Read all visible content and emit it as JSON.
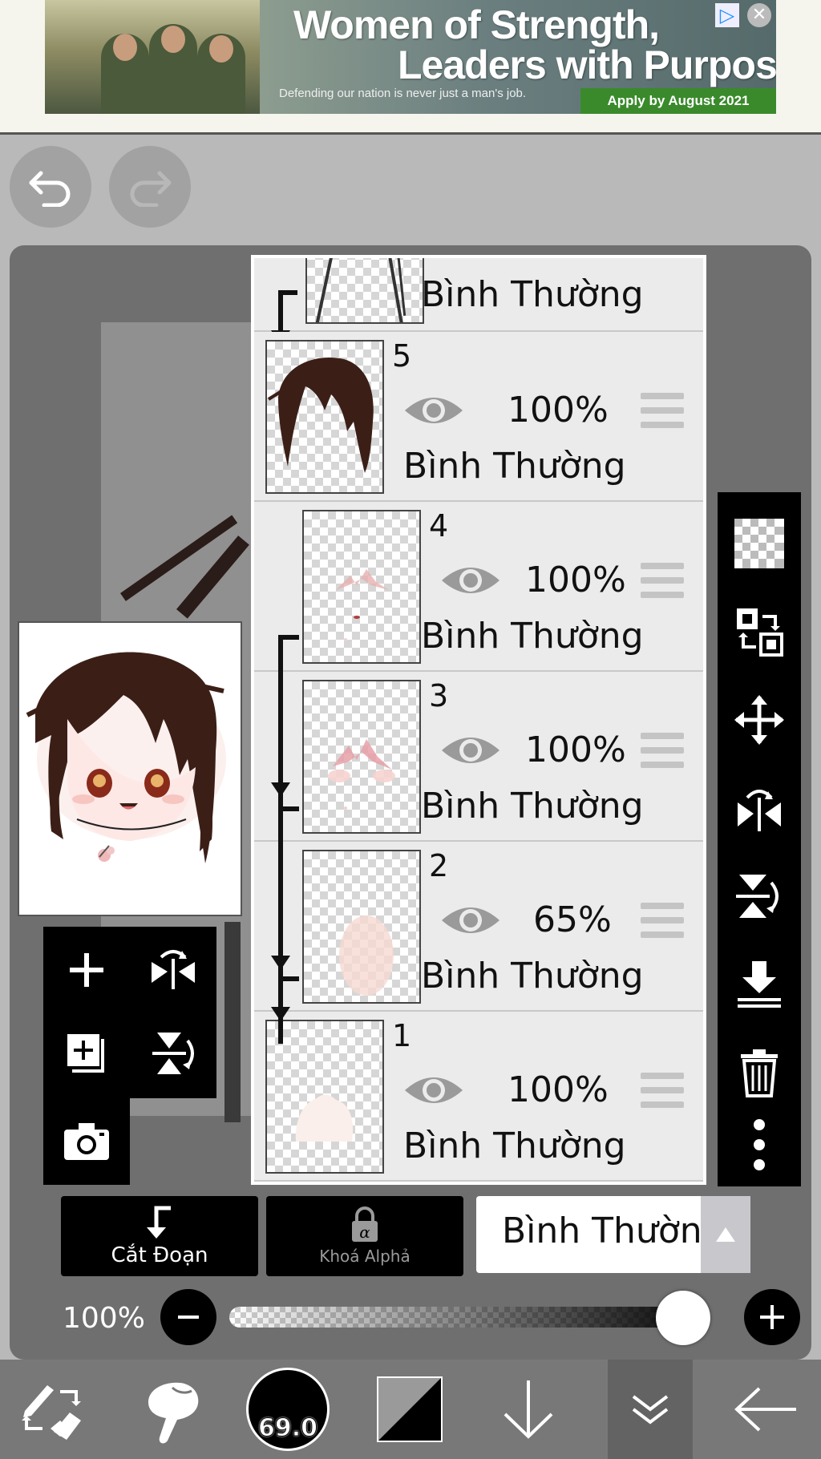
{
  "ad": {
    "title_line1": "Women of Strength,",
    "title_line2": "Leaders with Purpose.",
    "subtitle": "Defending our nation is never just a man's job.",
    "cta": "Apply by August 2021"
  },
  "history": {
    "undo_icon": "undo-icon",
    "redo_icon": "redo-icon"
  },
  "layers": [
    {
      "num": "",
      "opacity": "",
      "blend": "Bình Thường",
      "visible": true,
      "clipped": true,
      "partial": true
    },
    {
      "num": "5",
      "opacity": "100%",
      "blend": "Bình Thường",
      "visible": true,
      "clipped": false
    },
    {
      "num": "4",
      "opacity": "100%",
      "blend": "Bình Thường",
      "visible": true,
      "clipped": true
    },
    {
      "num": "3",
      "opacity": "100%",
      "blend": "Bình Thường",
      "visible": true,
      "clipped": true
    },
    {
      "num": "2",
      "opacity": "65%",
      "blend": "Bình Thường",
      "visible": true,
      "clipped": true
    },
    {
      "num": "1",
      "opacity": "100%",
      "blend": "Bình Thường",
      "visible": true,
      "clipped": false
    }
  ],
  "controls": {
    "clip_label": "Cắt Đoạn",
    "alpha_lock_label": "Khoá Alphả",
    "blend_mode": "Bình Thường",
    "opacity_label": "100%",
    "opacity_value": 1.0
  },
  "toolbar": {
    "brush_size": "69.0"
  },
  "colors": {
    "panel_bg": "#6f6f6f",
    "layer_bg": "#ebebeb",
    "hair_brown": "#3b1f17",
    "toolbar_black": "#000000"
  }
}
